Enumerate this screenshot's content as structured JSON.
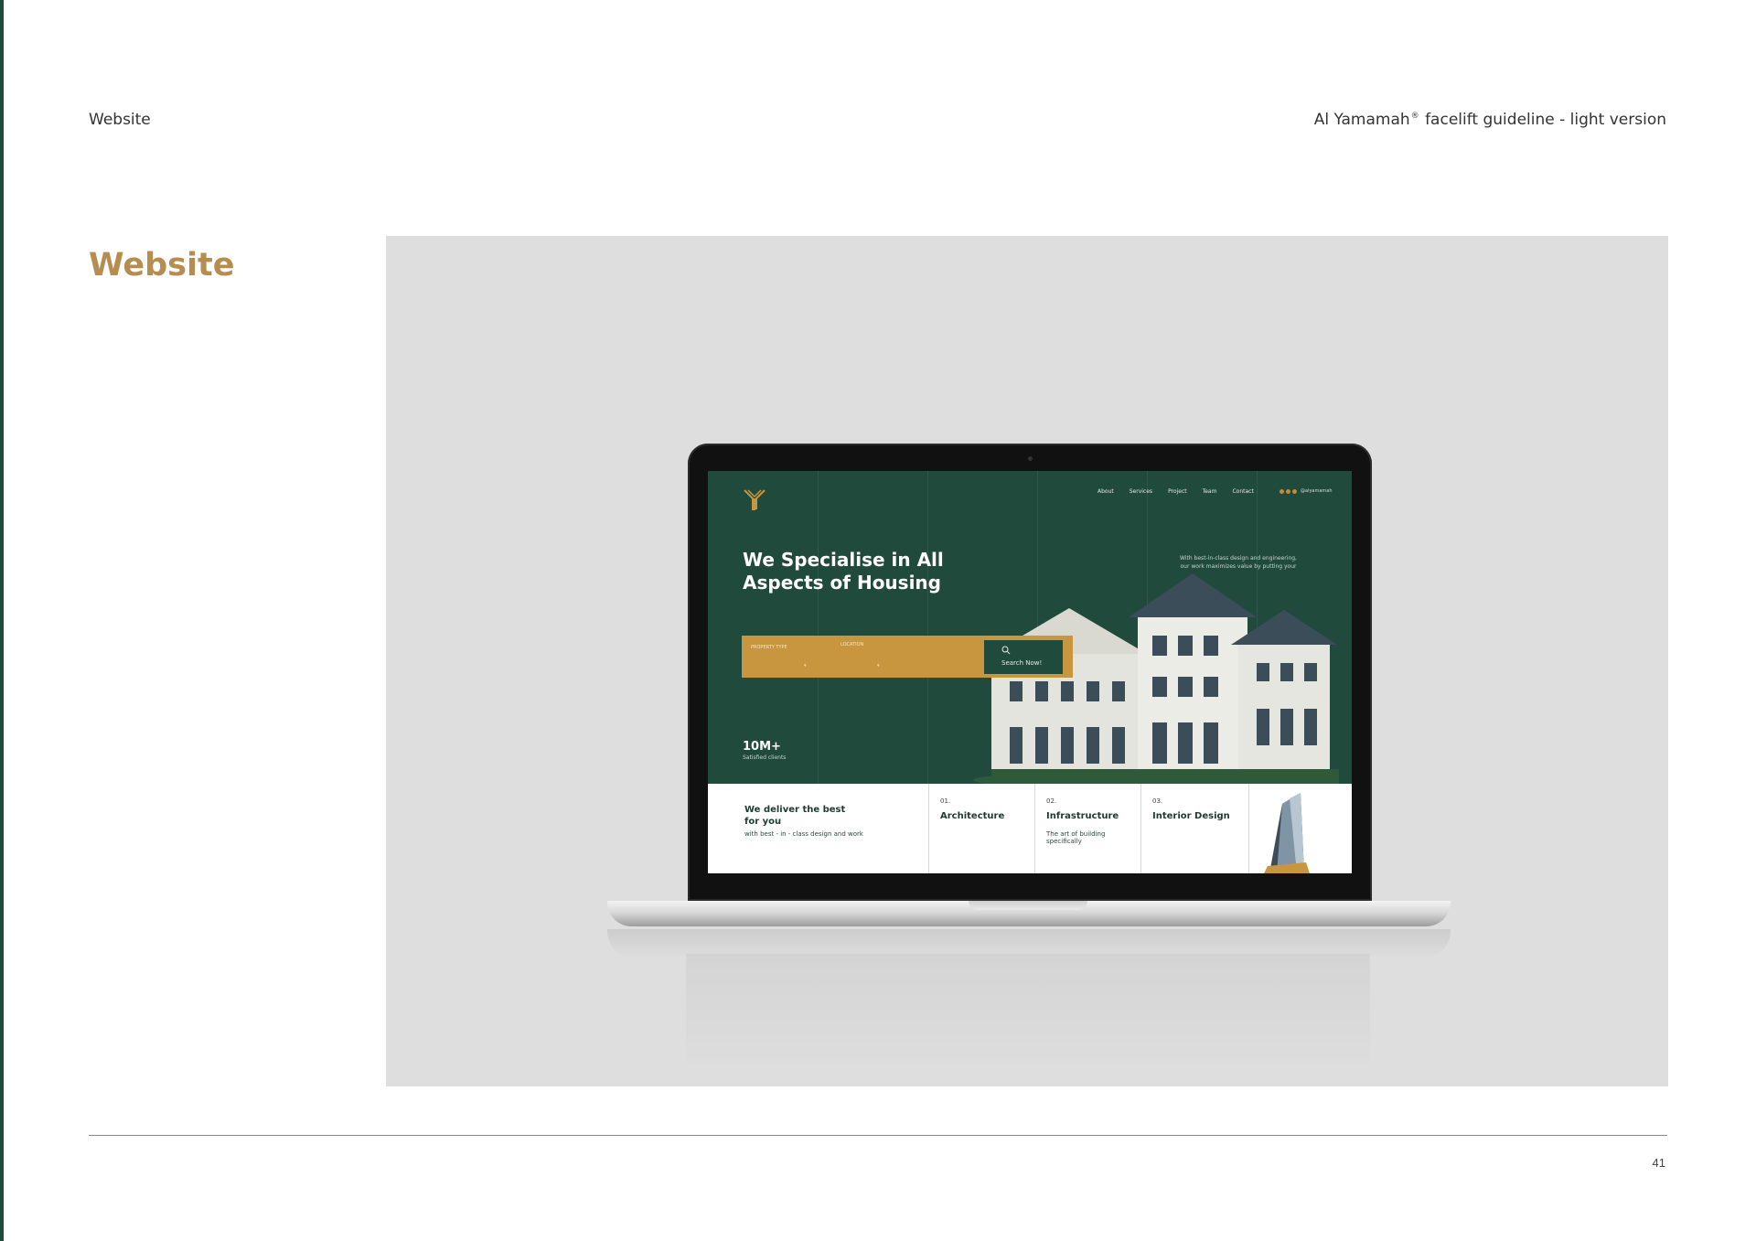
{
  "header": {
    "left": "Website",
    "brand": "Al Yamamah",
    "reg_mark": "®",
    "right_suffix": " facelift guideline - light version"
  },
  "section": {
    "title": "Website"
  },
  "mockup": {
    "nav": [
      "About",
      "Services",
      "Project",
      "Team",
      "Contact"
    ],
    "social_handle": "@alyamamah",
    "hero_title": "We Specialise in All Aspects of Housing",
    "hero_description": "With best-in-class design and engineering, our work maximizes value by putting your",
    "search": {
      "property_type_label": "PROPERTY TYPE",
      "location_label": "LOCATION",
      "button_label": "Search Now!"
    },
    "stat": {
      "value": "10M+",
      "label": "Satisfied clients"
    },
    "deliver": {
      "title": "We deliver the best for you",
      "description": "with best - in - class design and work"
    },
    "services": [
      {
        "number": "01.",
        "title": "Architecture",
        "description": ""
      },
      {
        "number": "02.",
        "title": "Infrastructure",
        "description": "The art of building specifically"
      },
      {
        "number": "03.",
        "title": "Interior Design",
        "description": ""
      }
    ]
  },
  "footer": {
    "page_number": "41"
  },
  "colors": {
    "accent_gold": "#b78c4f",
    "brand_green": "#1f4a3c",
    "search_gold": "#c8963e",
    "panel_gray": "#dedede"
  }
}
